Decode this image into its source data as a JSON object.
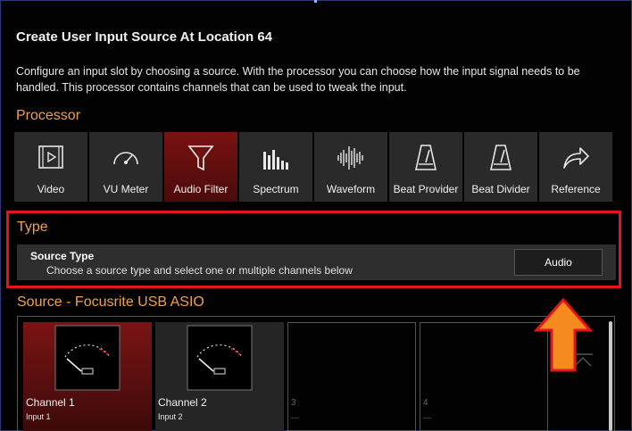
{
  "dialog": {
    "title": "Create User Input Source At Location 64",
    "description": "Configure an input slot by choosing a source. With the processor you can choose how the input signal needs to be handled. This processor contains channels that can be used to tweak the input."
  },
  "processor": {
    "heading": "Processor",
    "selected": "Audio Filter",
    "items": [
      {
        "label": "Video",
        "icon": "video-icon"
      },
      {
        "label": "VU Meter",
        "icon": "vu-meter-icon"
      },
      {
        "label": "Audio Filter",
        "icon": "filter-funnel-icon"
      },
      {
        "label": "Spectrum",
        "icon": "spectrum-icon"
      },
      {
        "label": "Waveform",
        "icon": "waveform-icon"
      },
      {
        "label": "Beat Provider",
        "icon": "metronome-icon"
      },
      {
        "label": "Beat Divider",
        "icon": "metronome-icon"
      },
      {
        "label": "Reference",
        "icon": "share-arrow-icon"
      }
    ]
  },
  "type": {
    "heading": "Type",
    "source_type_label": "Source Type",
    "source_type_desc": "Choose a source type and select one or multiple channels below",
    "source_type_value": "Audio"
  },
  "source": {
    "heading": "Source - Focusrite USB ASIO",
    "channels": [
      {
        "name": "Channel 1",
        "sub": "Input 1"
      },
      {
        "name": "Channel 2",
        "sub": "Input 2"
      },
      {
        "name": "3",
        "sub": "---"
      },
      {
        "name": "4",
        "sub": "---"
      }
    ]
  },
  "colors": {
    "accent": "#f0a14a",
    "highlight": "#e4151b",
    "selected": "#7a1212",
    "arrow": "#f58a1f"
  }
}
